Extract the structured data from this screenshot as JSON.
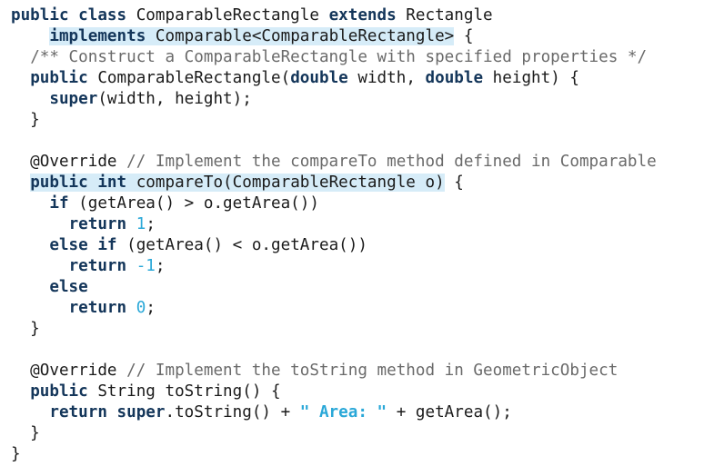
{
  "code": {
    "lines": [
      {
        "tokens": [
          {
            "t": "public class",
            "k": "keyword"
          },
          {
            "t": " ComparableRectangle ",
            "k": "plain"
          },
          {
            "t": "extends",
            "k": "keyword"
          },
          {
            "t": " Rectangle",
            "k": "plain"
          }
        ]
      },
      {
        "tokens": [
          {
            "t": "    ",
            "k": "plain"
          },
          {
            "t": "implements",
            "k": "keyword",
            "hl": true
          },
          {
            "t": " Comparable<ComparableRectangle>",
            "k": "plain",
            "hl": true
          },
          {
            "t": " {",
            "k": "plain"
          }
        ]
      },
      {
        "tokens": [
          {
            "t": "  ",
            "k": "plain"
          },
          {
            "t": "/** Construct a ComparableRectangle with specified properties */",
            "k": "comment"
          }
        ]
      },
      {
        "tokens": [
          {
            "t": "  ",
            "k": "plain"
          },
          {
            "t": "public",
            "k": "keyword"
          },
          {
            "t": " ComparableRectangle(",
            "k": "plain"
          },
          {
            "t": "double",
            "k": "keyword"
          },
          {
            "t": " width, ",
            "k": "plain"
          },
          {
            "t": "double",
            "k": "keyword"
          },
          {
            "t": " height) {",
            "k": "plain"
          }
        ]
      },
      {
        "tokens": [
          {
            "t": "    ",
            "k": "plain"
          },
          {
            "t": "super",
            "k": "keyword"
          },
          {
            "t": "(width, height);",
            "k": "plain"
          }
        ]
      },
      {
        "tokens": [
          {
            "t": "  }",
            "k": "plain"
          }
        ]
      },
      {
        "tokens": [
          {
            "t": "",
            "k": "plain"
          }
        ]
      },
      {
        "tokens": [
          {
            "t": "  @Override ",
            "k": "plain"
          },
          {
            "t": "// Implement the compareTo method defined in Comparable",
            "k": "comment"
          }
        ]
      },
      {
        "tokens": [
          {
            "t": "  ",
            "k": "plain"
          },
          {
            "t": "public int",
            "k": "keyword",
            "hl": true
          },
          {
            "t": " compareTo(ComparableRectangle o)",
            "k": "plain",
            "hl": true
          },
          {
            "t": " {",
            "k": "plain"
          }
        ]
      },
      {
        "tokens": [
          {
            "t": "    ",
            "k": "plain"
          },
          {
            "t": "if",
            "k": "keyword"
          },
          {
            "t": " (getArea() > o.getArea())",
            "k": "plain"
          }
        ]
      },
      {
        "tokens": [
          {
            "t": "      ",
            "k": "plain"
          },
          {
            "t": "return",
            "k": "keyword"
          },
          {
            "t": " ",
            "k": "plain"
          },
          {
            "t": "1",
            "k": "number"
          },
          {
            "t": ";",
            "k": "plain"
          }
        ]
      },
      {
        "tokens": [
          {
            "t": "    ",
            "k": "plain"
          },
          {
            "t": "else if",
            "k": "keyword"
          },
          {
            "t": " (getArea() < o.getArea())",
            "k": "plain"
          }
        ]
      },
      {
        "tokens": [
          {
            "t": "      ",
            "k": "plain"
          },
          {
            "t": "return",
            "k": "keyword"
          },
          {
            "t": " ",
            "k": "plain"
          },
          {
            "t": "-1",
            "k": "number"
          },
          {
            "t": ";",
            "k": "plain"
          }
        ]
      },
      {
        "tokens": [
          {
            "t": "    ",
            "k": "plain"
          },
          {
            "t": "else",
            "k": "keyword"
          }
        ]
      },
      {
        "tokens": [
          {
            "t": "      ",
            "k": "plain"
          },
          {
            "t": "return",
            "k": "keyword"
          },
          {
            "t": " ",
            "k": "plain"
          },
          {
            "t": "0",
            "k": "number"
          },
          {
            "t": ";",
            "k": "plain"
          }
        ]
      },
      {
        "tokens": [
          {
            "t": "  }",
            "k": "plain"
          }
        ]
      },
      {
        "tokens": [
          {
            "t": "",
            "k": "plain"
          }
        ]
      },
      {
        "tokens": [
          {
            "t": "  @Override ",
            "k": "plain"
          },
          {
            "t": "// Implement the toString method in GeometricObject",
            "k": "comment"
          }
        ]
      },
      {
        "tokens": [
          {
            "t": "  ",
            "k": "plain"
          },
          {
            "t": "public",
            "k": "keyword"
          },
          {
            "t": " String toString() {",
            "k": "plain"
          }
        ]
      },
      {
        "tokens": [
          {
            "t": "    ",
            "k": "plain"
          },
          {
            "t": "return super",
            "k": "keyword"
          },
          {
            "t": ".toString() + ",
            "k": "plain"
          },
          {
            "t": "\" Area: \"",
            "k": "string"
          },
          {
            "t": " + getArea();",
            "k": "plain"
          }
        ]
      },
      {
        "tokens": [
          {
            "t": "  }",
            "k": "plain"
          }
        ]
      },
      {
        "tokens": [
          {
            "t": "}",
            "k": "plain"
          }
        ]
      }
    ]
  },
  "colors": {
    "keyword": "#14365a",
    "comment": "#6a6a6a",
    "literal": "#2aa8d8",
    "highlight": "#d6ecf8"
  }
}
